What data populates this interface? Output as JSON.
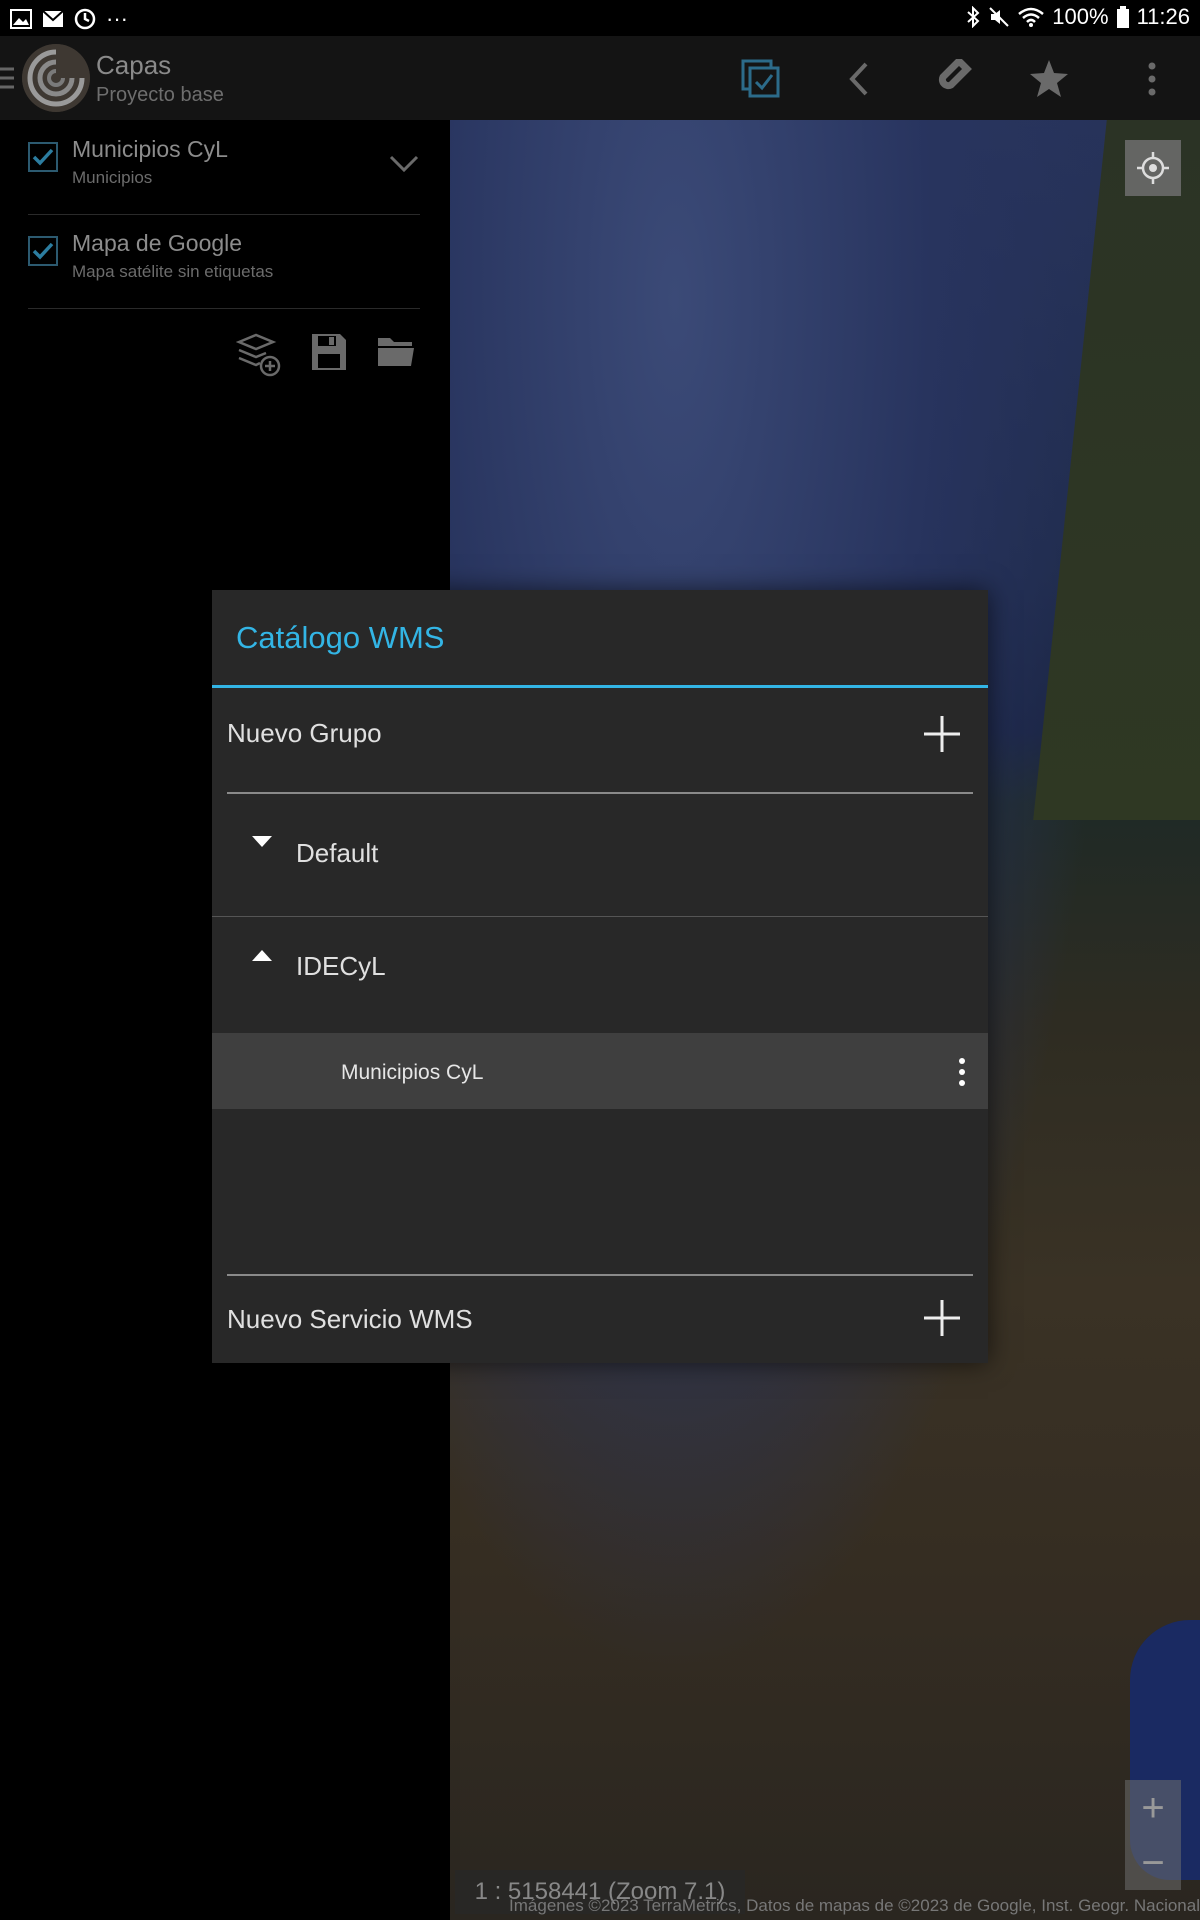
{
  "status_bar": {
    "battery": "100%",
    "time": "11:26",
    "more_glyph": "···"
  },
  "app_bar": {
    "title": "Capas",
    "subtitle": "Proyecto base"
  },
  "layers": [
    {
      "title": "Municipios CyL",
      "subtitle": "Municipios",
      "checked": true
    },
    {
      "title": "Mapa de Google",
      "subtitle": "Mapa satélite sin etiquetas",
      "checked": true
    }
  ],
  "map": {
    "scale_label": "1 : 5158441 (Zoom 7.1)",
    "attribution": "Imágenes ©2023 TerraMetrics, Datos de mapas de ©2023 de Google, Inst. Geogr. Nacional",
    "zoom_in": "+",
    "zoom_out": "−"
  },
  "dialog": {
    "title": "Catálogo WMS",
    "new_group_label": "Nuevo Grupo",
    "groups": [
      {
        "name": "Default",
        "expanded": false
      },
      {
        "name": "IDECyL",
        "expanded": true,
        "items": [
          "Municipios CyL"
        ]
      }
    ],
    "new_service_label": "Nuevo Servicio WMS"
  },
  "colors": {
    "accent": "#33b5e5",
    "dialog_bg": "#282828",
    "selected_row": "#3f3f3f"
  }
}
